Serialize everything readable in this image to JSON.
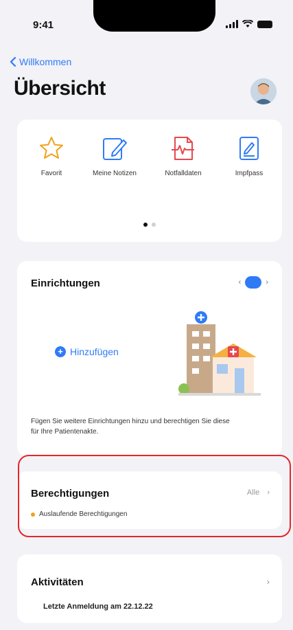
{
  "status_bar": {
    "time": "9:41"
  },
  "nav": {
    "back_label": "Willkommen"
  },
  "page": {
    "title": "Übersicht"
  },
  "quick_actions": [
    {
      "label": "Favorit",
      "icon": "star-icon"
    },
    {
      "label": "Meine Notizen",
      "icon": "notes-icon"
    },
    {
      "label": "Notfalldaten",
      "icon": "emergency-data-icon"
    },
    {
      "label": "Impfpass",
      "icon": "vaccination-pass-icon"
    }
  ],
  "facilities": {
    "title": "Einrichtungen",
    "pager_left": "‹",
    "pager_right": "›",
    "add_label": "Hinzufügen",
    "description": "Fügen Sie weitere Einrichtungen hinzu und berechtigen Sie diese für Ihre Patientenakte."
  },
  "permissions": {
    "title": "Berechtigungen",
    "right_label": "Alle",
    "chevron": "›",
    "sub_label": "Auslaufende Berechtigungen"
  },
  "activity": {
    "title": "Aktivitäten",
    "chevron": "›",
    "last_login": "Letzte Anmeldung am 22.12.22"
  },
  "colors": {
    "accent": "#2f7bf5",
    "star": "#f0a11a",
    "emergency": "#e5484d",
    "highlight": "#e5252a",
    "background": "#f2f2f7"
  }
}
